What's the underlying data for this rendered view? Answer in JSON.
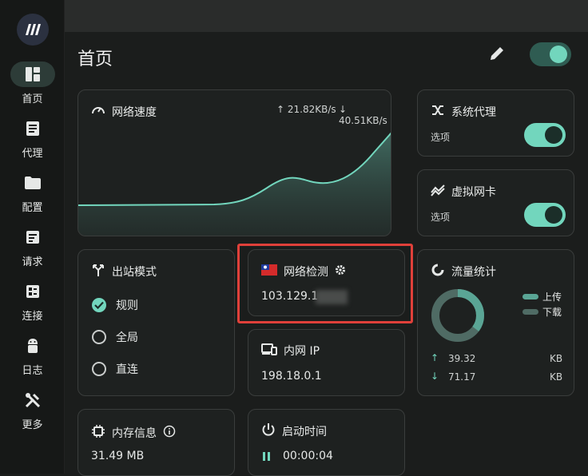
{
  "sidebar": {
    "items": [
      {
        "label": "首页",
        "icon": "dashboard-icon"
      },
      {
        "label": "代理",
        "icon": "list-icon"
      },
      {
        "label": "配置",
        "icon": "folder-icon"
      },
      {
        "label": "请求",
        "icon": "request-icon"
      },
      {
        "label": "连接",
        "icon": "connection-icon"
      },
      {
        "label": "日志",
        "icon": "android-icon"
      },
      {
        "label": "更多",
        "icon": "tools-icon"
      }
    ]
  },
  "header": {
    "title": "首页"
  },
  "network_speed": {
    "title": "网络速度",
    "up": "↑ 21.82KB/s",
    "down": "↓ 40.51KB/s"
  },
  "system_proxy": {
    "title": "系统代理",
    "option_label": "选项",
    "enabled": true
  },
  "tun": {
    "title": "虚拟网卡",
    "option_label": "选项",
    "enabled": true
  },
  "outbound_mode": {
    "title": "出站模式",
    "options": [
      "规则",
      "全局",
      "直连"
    ],
    "selected": "规则"
  },
  "network_check": {
    "title": "网络检测",
    "ip": "103.129.1"
  },
  "lan_ip": {
    "title": "内网 IP",
    "ip": "198.18.0.1"
  },
  "traffic": {
    "title": "流量统计",
    "legend_up": "上传",
    "legend_down": "下载",
    "up_value": "39.32",
    "up_unit": "KB",
    "down_value": "71.17",
    "down_unit": "KB"
  },
  "memory": {
    "title": "内存信息",
    "value": "31.49  MB"
  },
  "uptime": {
    "title": "启动时间",
    "value": "00:00:04"
  },
  "colors": {
    "accent": "#72d6bd",
    "highlight": "#e0403a"
  }
}
